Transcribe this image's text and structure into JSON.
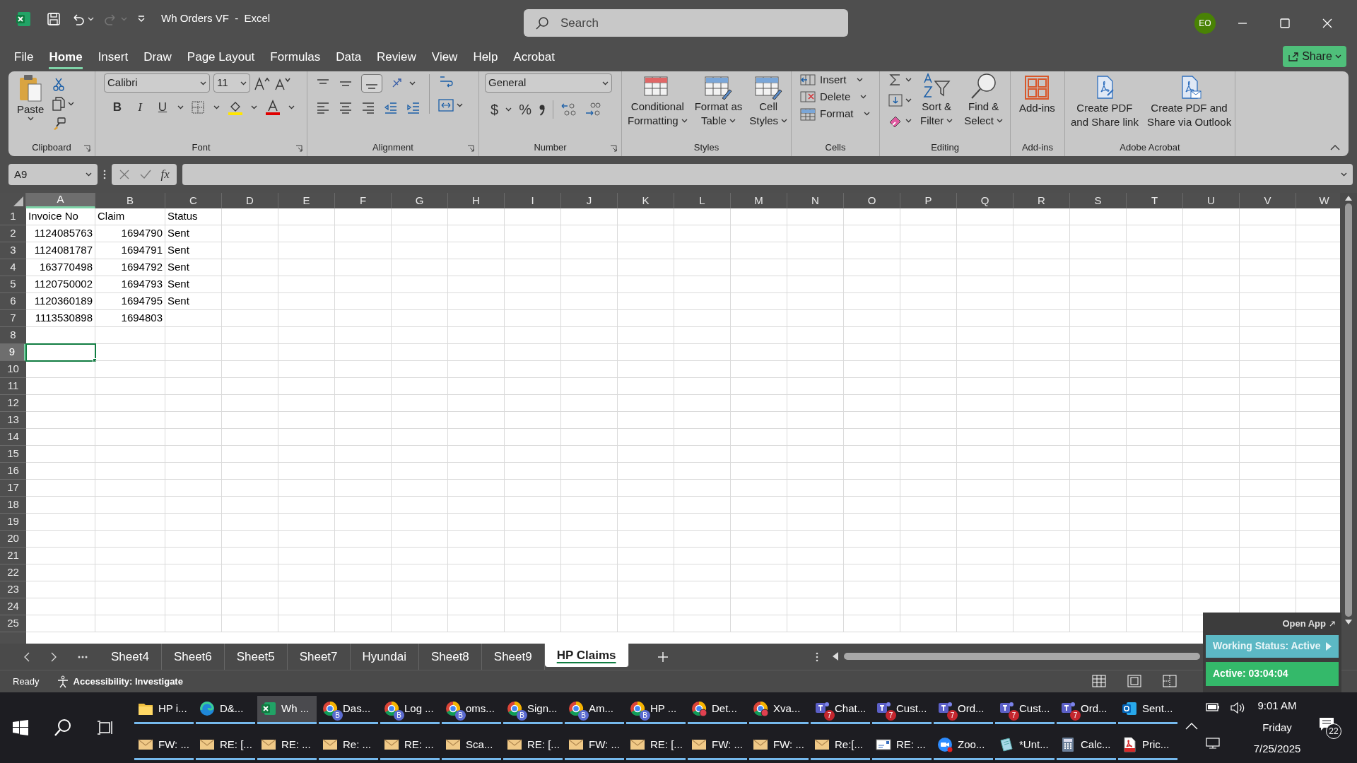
{
  "window": {
    "title": "Wh Orders VF  -  Excel",
    "search_placeholder": "Search",
    "account_initials": "EO"
  },
  "menu": [
    {
      "label": "File",
      "selected": false
    },
    {
      "label": "Home",
      "selected": true
    },
    {
      "label": "Insert",
      "selected": false
    },
    {
      "label": "Draw",
      "selected": false
    },
    {
      "label": "Page Layout",
      "selected": false
    },
    {
      "label": "Formulas",
      "selected": false
    },
    {
      "label": "Data",
      "selected": false
    },
    {
      "label": "Review",
      "selected": false
    },
    {
      "label": "View",
      "selected": false
    },
    {
      "label": "Help",
      "selected": false
    },
    {
      "label": "Acrobat",
      "selected": false
    }
  ],
  "share_button": "Share",
  "ribbon": {
    "groups": [
      {
        "label": "Clipboard",
        "launcher": true,
        "buttons": [
          {
            "lines": [
              "Paste"
            ],
            "has_menu": true
          }
        ]
      },
      {
        "label": "Font",
        "launcher": true,
        "font": "Calibri",
        "size": "11",
        "styles": [
          "B",
          "I",
          "U"
        ]
      },
      {
        "label": "Alignment",
        "launcher": true
      },
      {
        "label": "Number",
        "launcher": true,
        "format": "General",
        "symbols": [
          "$",
          "%"
        ]
      },
      {
        "label": "Styles",
        "launcher": false,
        "buttons": [
          {
            "lines": [
              "Conditional",
              "Formatting"
            ],
            "has_menu": true
          },
          {
            "lines": [
              "Format as",
              "Table"
            ],
            "has_menu": true
          },
          {
            "lines": [
              "Cell",
              "Styles"
            ],
            "has_menu": true
          }
        ]
      },
      {
        "label": "Cells",
        "launcher": false,
        "buttons": [
          {
            "lines": [
              "Insert"
            ],
            "has_menu": true
          },
          {
            "lines": [
              "Delete"
            ],
            "has_menu": true
          },
          {
            "lines": [
              "Format"
            ],
            "has_menu": true
          }
        ]
      },
      {
        "label": "Editing",
        "launcher": false,
        "buttons": [
          {
            "lines": [
              "Sort &",
              "Filter"
            ],
            "has_menu": true
          },
          {
            "lines": [
              "Find &",
              "Select"
            ],
            "has_menu": true
          }
        ]
      },
      {
        "label": "Add-ins",
        "launcher": false,
        "buttons": [
          {
            "lines": [
              "Add-ins"
            ],
            "has_menu": false
          }
        ]
      },
      {
        "label": "Adobe Acrobat",
        "launcher": false,
        "buttons": [
          {
            "lines": [
              "Create PDF",
              "and Share link"
            ],
            "has_menu": false
          },
          {
            "lines": [
              "Create PDF and",
              "Share via Outlook"
            ],
            "has_menu": false
          }
        ]
      }
    ]
  },
  "formula_bar": {
    "name_box": "A9",
    "function_label": "fx"
  },
  "sheet": {
    "columns": [
      {
        "label": "A",
        "selected": true
      },
      {
        "label": "B",
        "selected": false
      },
      {
        "label": "C",
        "selected": false
      },
      {
        "label": "D",
        "selected": false
      },
      {
        "label": "E",
        "selected": false
      },
      {
        "label": "F",
        "selected": false
      },
      {
        "label": "G",
        "selected": false
      },
      {
        "label": "H",
        "selected": false
      },
      {
        "label": "I",
        "selected": false
      },
      {
        "label": "J",
        "selected": false
      },
      {
        "label": "K",
        "selected": false
      },
      {
        "label": "L",
        "selected": false
      },
      {
        "label": "M",
        "selected": false
      },
      {
        "label": "N",
        "selected": false
      },
      {
        "label": "O",
        "selected": false
      },
      {
        "label": "P",
        "selected": false
      },
      {
        "label": "Q",
        "selected": false
      },
      {
        "label": "R",
        "selected": false
      },
      {
        "label": "S",
        "selected": false
      },
      {
        "label": "T",
        "selected": false
      },
      {
        "label": "U",
        "selected": false
      },
      {
        "label": "V",
        "selected": false
      },
      {
        "label": "W",
        "selected": false
      }
    ],
    "rows": [
      {
        "header": "1",
        "selected": false,
        "cells": [
          {
            "text": "Invoice No",
            "kind": "text"
          },
          {
            "text": "Claim",
            "kind": "text"
          },
          {
            "text": "Status",
            "kind": "text"
          }
        ]
      },
      {
        "header": "2",
        "selected": false,
        "cells": [
          {
            "text": "1124085763",
            "kind": "number"
          },
          {
            "text": "1694790",
            "kind": "number"
          },
          {
            "text": "Sent",
            "kind": "text"
          }
        ]
      },
      {
        "header": "3",
        "selected": false,
        "cells": [
          {
            "text": "1124081787",
            "kind": "number"
          },
          {
            "text": "1694791",
            "kind": "number"
          },
          {
            "text": "Sent",
            "kind": "text"
          }
        ]
      },
      {
        "header": "4",
        "selected": false,
        "cells": [
          {
            "text": "163770498",
            "kind": "number"
          },
          {
            "text": "1694792",
            "kind": "number"
          },
          {
            "text": "Sent",
            "kind": "text"
          }
        ]
      },
      {
        "header": "5",
        "selected": false,
        "cells": [
          {
            "text": "1120750002",
            "kind": "number"
          },
          {
            "text": "1694793",
            "kind": "number"
          },
          {
            "text": "Sent",
            "kind": "text"
          }
        ]
      },
      {
        "header": "6",
        "selected": false,
        "cells": [
          {
            "text": "1120360189",
            "kind": "number"
          },
          {
            "text": "1694795",
            "kind": "number"
          },
          {
            "text": "Sent",
            "kind": "text"
          }
        ]
      },
      {
        "header": "7",
        "selected": false,
        "cells": [
          {
            "text": "1113530898",
            "kind": "number"
          },
          {
            "text": "1694803",
            "kind": "number"
          }
        ]
      },
      {
        "header": "8",
        "selected": false,
        "cells": []
      },
      {
        "header": "9",
        "selected": true,
        "cells": []
      },
      {
        "header": "10",
        "selected": false,
        "cells": []
      },
      {
        "header": "11",
        "selected": false,
        "cells": []
      },
      {
        "header": "12",
        "selected": false,
        "cells": []
      },
      {
        "header": "13",
        "selected": false,
        "cells": []
      },
      {
        "header": "14",
        "selected": false,
        "cells": []
      },
      {
        "header": "15",
        "selected": false,
        "cells": []
      },
      {
        "header": "16",
        "selected": false,
        "cells": []
      },
      {
        "header": "17",
        "selected": false,
        "cells": []
      },
      {
        "header": "18",
        "selected": false,
        "cells": []
      },
      {
        "header": "19",
        "selected": false,
        "cells": []
      },
      {
        "header": "20",
        "selected": false,
        "cells": []
      },
      {
        "header": "21",
        "selected": false,
        "cells": []
      },
      {
        "header": "22",
        "selected": false,
        "cells": []
      },
      {
        "header": "23",
        "selected": false,
        "cells": []
      },
      {
        "header": "24",
        "selected": false,
        "cells": []
      },
      {
        "header": "25",
        "selected": false,
        "cells": []
      }
    ]
  },
  "sheet_tabs": [
    {
      "label": "Sheet4",
      "selected": false
    },
    {
      "label": "Sheet6",
      "selected": false
    },
    {
      "label": "Sheet5",
      "selected": false
    },
    {
      "label": "Sheet7",
      "selected": false
    },
    {
      "label": "Hyundai",
      "selected": false
    },
    {
      "label": "Sheet8",
      "selected": false
    },
    {
      "label": "Sheet9",
      "selected": false
    },
    {
      "label": "HP Claims",
      "selected": true
    }
  ],
  "status_bar": {
    "mode": "Ready",
    "accessibility": "Accessibility: Investigate"
  },
  "overlay": {
    "link": "Open App",
    "status": "Working Status: Active",
    "timer": "Active: 03:04:04"
  },
  "taskbar": {
    "top": [
      {
        "label": "HP i...",
        "kind": "folder",
        "selected": false
      },
      {
        "label": "D&...",
        "kind": "edge",
        "selected": false
      },
      {
        "label": "Wh ...",
        "kind": "excel",
        "selected": true
      },
      {
        "label": "Das...",
        "kind": "chrome",
        "badge": "B",
        "selected": false
      },
      {
        "label": "Log ...",
        "kind": "chrome",
        "badge": "B",
        "selected": false
      },
      {
        "label": "oms...",
        "kind": "chrome",
        "badge": "B",
        "selected": false
      },
      {
        "label": "Sign...",
        "kind": "chrome",
        "badge": "B",
        "selected": false
      },
      {
        "label": "Am...",
        "kind": "chrome",
        "badge": "B",
        "selected": false
      },
      {
        "label": "HP ...",
        "kind": "chrome",
        "badge": "B",
        "selected": false
      },
      {
        "label": "Det...",
        "kind": "chrome-red",
        "selected": false
      },
      {
        "label": "Xva...",
        "kind": "chrome-red",
        "selected": false
      },
      {
        "label": "Chat...",
        "kind": "teams",
        "badge": "7",
        "selected": false
      },
      {
        "label": "Cust...",
        "kind": "teams",
        "badge": "7",
        "selected": false
      },
      {
        "label": "Ord...",
        "kind": "teams",
        "badge": "7",
        "selected": false
      },
      {
        "label": "Cust...",
        "kind": "teams",
        "badge": "7",
        "selected": false
      },
      {
        "label": "Ord...",
        "kind": "teams",
        "badge": "7",
        "selected": false
      },
      {
        "label": "Sent...",
        "kind": "outlook",
        "selected": false
      }
    ],
    "bottom": [
      {
        "label": "FW: ...",
        "kind": "mail",
        "selected": false
      },
      {
        "label": "RE: [...",
        "kind": "mail",
        "selected": false
      },
      {
        "label": "RE: ...",
        "kind": "mail",
        "selected": false
      },
      {
        "label": "Re: ...",
        "kind": "mail",
        "selected": false
      },
      {
        "label": "RE: ...",
        "kind": "mail",
        "selected": false
      },
      {
        "label": "Sca...",
        "kind": "mail",
        "selected": false
      },
      {
        "label": "RE: [...",
        "kind": "mail",
        "selected": false
      },
      {
        "label": "FW: ...",
        "kind": "mail",
        "selected": false
      },
      {
        "label": "RE: [...",
        "kind": "mail",
        "selected": false
      },
      {
        "label": "FW: ...",
        "kind": "mail",
        "selected": false
      },
      {
        "label": "FW: ...",
        "kind": "mail",
        "selected": false
      },
      {
        "label": "Re:[...",
        "kind": "mail",
        "selected": false
      },
      {
        "label": "RE: ...",
        "kind": "letter",
        "selected": false
      },
      {
        "label": "Zoo...",
        "kind": "zoom",
        "selected": false
      },
      {
        "label": "*Unt...",
        "kind": "notepad",
        "selected": false
      },
      {
        "label": "Calc...",
        "kind": "calculator",
        "selected": false
      },
      {
        "label": "Pric...",
        "kind": "pdf",
        "selected": false
      }
    ]
  },
  "clock": {
    "time": "9:01 AM",
    "day": "Friday",
    "date": "7/25/2025"
  },
  "notifications": {
    "count": "22"
  }
}
